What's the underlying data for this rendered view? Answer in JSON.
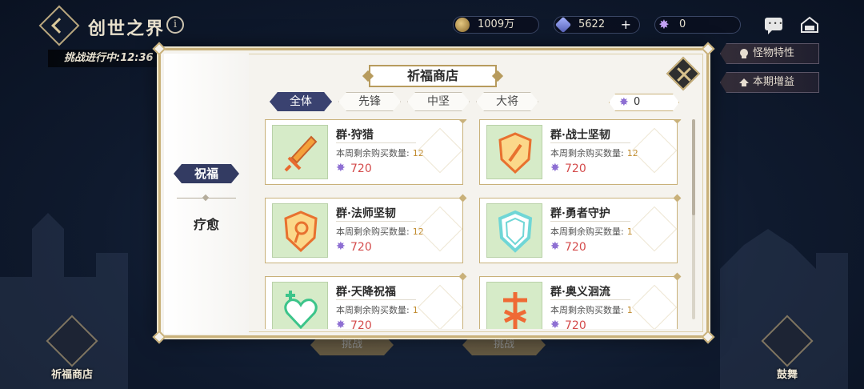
{
  "header": {
    "title": "创世之界",
    "info_glyph": "i",
    "resources": [
      {
        "icon": "coin-icon",
        "value": "1009万",
        "has_plus": false
      },
      {
        "icon": "gem-icon",
        "value": "5622",
        "has_plus": true,
        "plus": "+"
      },
      {
        "icon": "star-currency-icon",
        "value": "0",
        "has_plus": false
      }
    ],
    "challenge_status": "挑战进行中:12:36"
  },
  "side_buttons": [
    {
      "label": "怪物特性",
      "icon": "skull-icon"
    },
    {
      "label": "本期增益",
      "icon": "buff-icon"
    }
  ],
  "bottom": {
    "left_button": "祈福商店",
    "right_button": "鼓舞",
    "ghost_buttons": [
      "挑战",
      "挑战"
    ]
  },
  "shop": {
    "title": "祈福商店",
    "category": {
      "tag": "祝福",
      "item": "疗愈"
    },
    "tabs": [
      {
        "label": "全体",
        "active": true
      },
      {
        "label": "先锋",
        "active": false
      },
      {
        "label": "中坚",
        "active": false
      },
      {
        "label": "大将",
        "active": false
      }
    ],
    "currency": "0",
    "remain_label": "本周剩余购买数量:",
    "items": [
      {
        "name": "群·狩猎",
        "remain": "12",
        "price": "720",
        "icon": "sword-icon"
      },
      {
        "name": "群·战士坚韧",
        "remain": "12",
        "price": "720",
        "icon": "shield-sword-icon"
      },
      {
        "name": "群·法师坚韧",
        "remain": "12",
        "price": "720",
        "icon": "shield-staff-icon"
      },
      {
        "name": "群·勇者守护",
        "remain": "1",
        "price": "720",
        "icon": "shield-icon"
      },
      {
        "name": "群·天降祝福",
        "remain": "1",
        "price": "720",
        "icon": "heart-heal-icon"
      },
      {
        "name": "群·奥义洄流",
        "remain": "1",
        "price": "720",
        "icon": "rune-icon"
      }
    ]
  }
}
